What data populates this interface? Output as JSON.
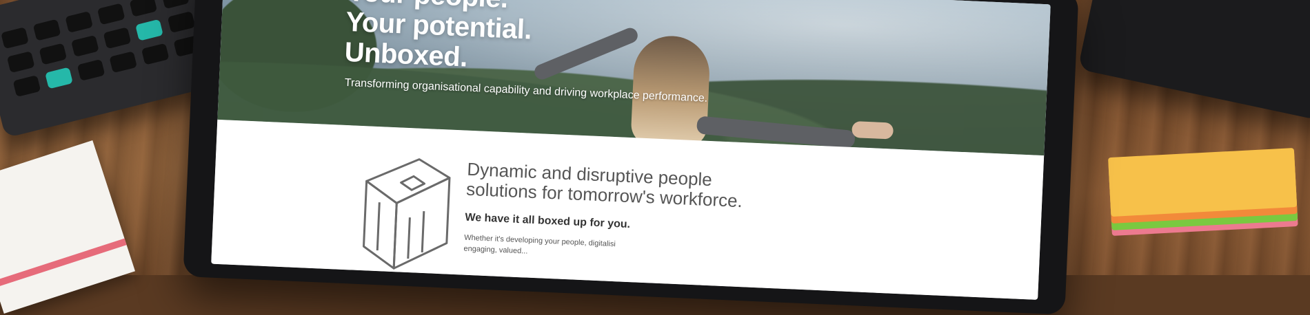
{
  "hero": {
    "headline_lines": [
      "Your people.",
      "Your potential.",
      "Unboxed."
    ],
    "tagline": "Transforming organisational capability and driving workplace performance."
  },
  "section": {
    "heading_lines": [
      "Dynamic and disruptive people",
      "solutions for tomorrow's workforce."
    ],
    "subheading": "We have it all boxed up for you.",
    "body_lines": [
      "Whether it's developing your people, digitalisi",
      "engaging, valued..."
    ]
  },
  "colors": {
    "hero_text": "#ffffff",
    "heading_text": "#555555",
    "sticky_notes": [
      "#f7c14a",
      "#f28a3a",
      "#7ac940",
      "#ec7a8f"
    ],
    "calculator_accent": "#25b8a9"
  }
}
